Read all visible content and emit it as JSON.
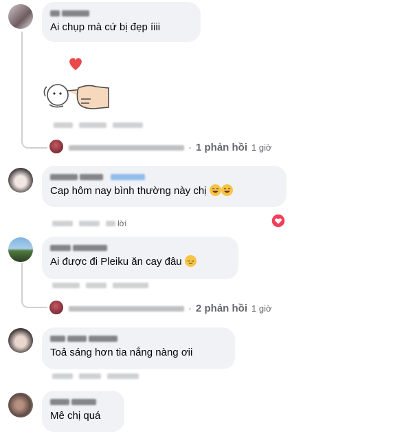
{
  "comments": [
    {
      "text": "Ai chụp mà cứ bị đẹp íiii",
      "replies": {
        "count": "1 phản hồi",
        "time": "1 giờ"
      }
    },
    {
      "text": "Cap hôm nay bình thường này chị ",
      "action_reply": "lời"
    },
    {
      "text": "Ai được đi Pleiku ăn cay đâu ",
      "replies": {
        "count": "2 phản hồi",
        "time": "1 giờ"
      }
    },
    {
      "text": "Toả sáng hơn tia nắng nàng ơii"
    },
    {
      "text": "Mê chị quá"
    }
  ],
  "colors": {
    "bubble": "#f0f2f5",
    "muted": "#65676b",
    "reaction": "#f33e58",
    "text": "#050505"
  },
  "icons": [
    "heart-reaction-icon",
    "laughing-emoji-icon",
    "pensive-emoji-icon",
    "pointing-hand-sticker"
  ]
}
